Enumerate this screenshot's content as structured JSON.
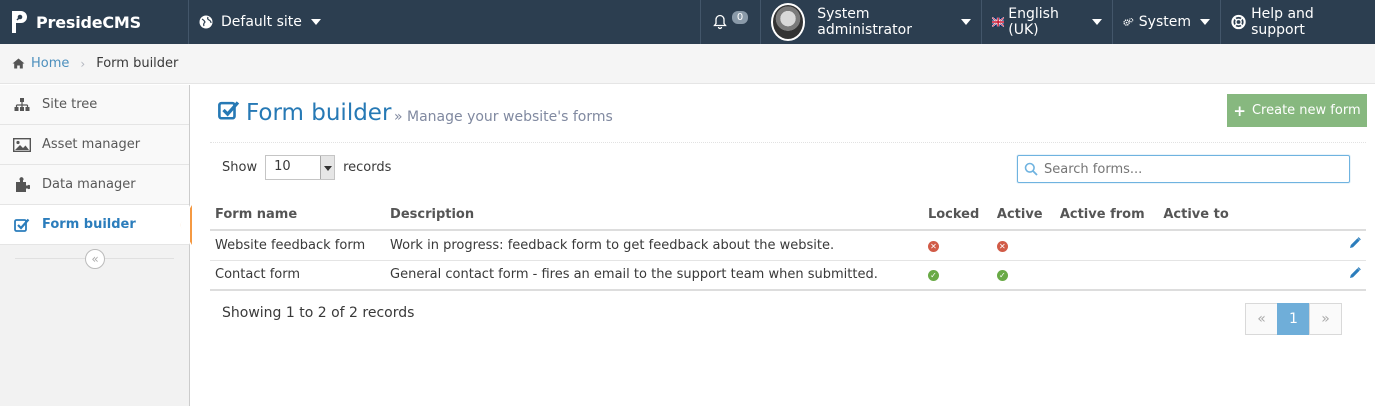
{
  "navbar": {
    "brand": "PresideCMS",
    "site_selector": "Default site",
    "notifications_count": "0",
    "user_name": "System administrator",
    "language": "English (UK)",
    "system_menu": "System",
    "help_menu": "Help and support"
  },
  "breadcrumb": {
    "home": "Home",
    "current": "Form builder"
  },
  "sidebar": {
    "items": [
      {
        "label": "Site tree",
        "icon": "sitemap-icon"
      },
      {
        "label": "Asset manager",
        "icon": "image-icon"
      },
      {
        "label": "Data manager",
        "icon": "puzzle-icon"
      },
      {
        "label": "Form builder",
        "icon": "check-square-icon",
        "active": true
      }
    ],
    "collapse_icon": "double-angle-left-icon"
  },
  "header": {
    "title": "Form builder",
    "subtitle": "Manage your website's forms",
    "create_button": "Create new form"
  },
  "table_controls": {
    "show_label": "Show",
    "page_length": "10",
    "records_label": "records",
    "search_placeholder": "Search forms..."
  },
  "table": {
    "columns": [
      "Form name",
      "Description",
      "Locked",
      "Active",
      "Active from",
      "Active to"
    ],
    "rows": [
      {
        "name": "Website feedback form",
        "description": "Work in progress: feedback form to get feedback about the website.",
        "locked": false,
        "active": false,
        "active_from": "",
        "active_to": ""
      },
      {
        "name": "Contact form",
        "description": "General contact form - fires an email to the support team when submitted.",
        "locked": true,
        "active": true,
        "active_from": "",
        "active_to": ""
      }
    ]
  },
  "footer": {
    "info": "Showing 1 to 2 of 2 records",
    "pagination": {
      "prev": "«",
      "current": "1",
      "next": "»"
    }
  },
  "colors": {
    "navbar_bg": "#2c3e50",
    "accent_blue": "#2679b5",
    "create_button_green": "#87b87f",
    "status_no_red": "#d15b47",
    "status_yes_green": "#69aa46",
    "sidebar_active_marker": "#f59942"
  }
}
